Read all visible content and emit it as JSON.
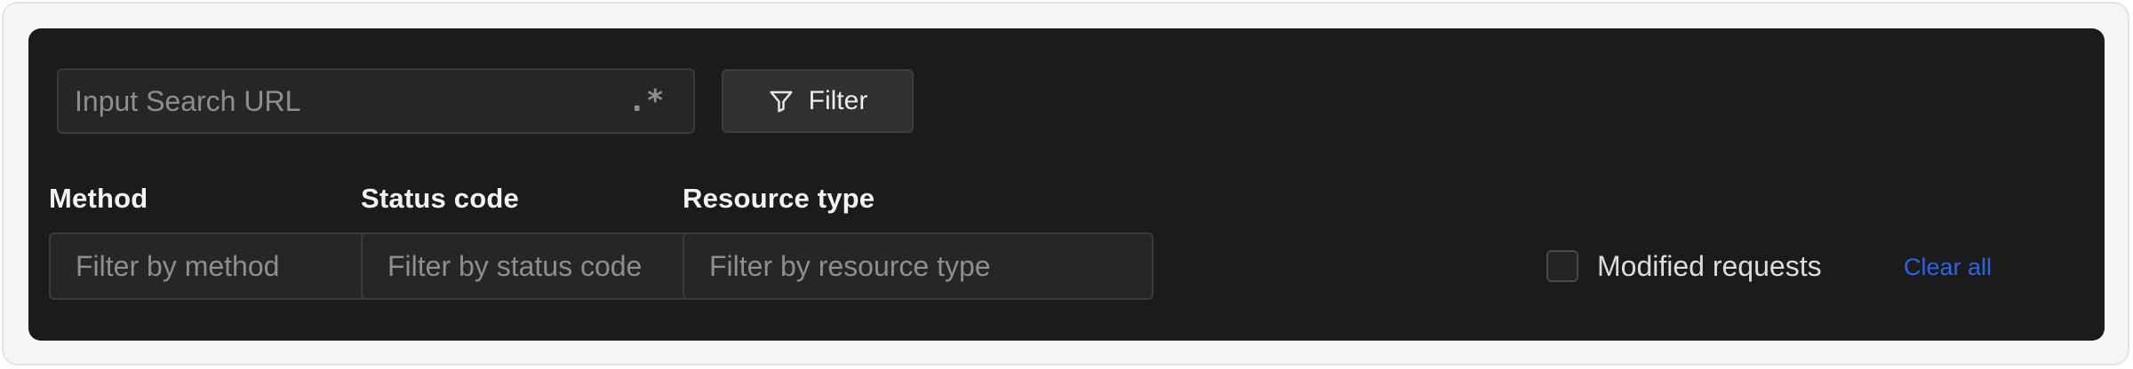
{
  "search": {
    "placeholder": "Input Search URL",
    "regex_toggle_label": ".*"
  },
  "toolbar": {
    "filter_label": "Filter",
    "filter_icon": "funnel-icon"
  },
  "filters": {
    "method": {
      "label": "Method",
      "placeholder": "Filter by method"
    },
    "status_code": {
      "label": "Status code",
      "placeholder": "Filter by status code"
    },
    "resource_type": {
      "label": "Resource type",
      "placeholder": "Filter by resource type"
    },
    "modified_requests": {
      "label": "Modified requests",
      "checked": false
    },
    "clear_all_label": "Clear all"
  },
  "colors": {
    "panel_background": "#1b1b1b",
    "input_background": "#262626",
    "link_accent": "#2f63e6"
  }
}
